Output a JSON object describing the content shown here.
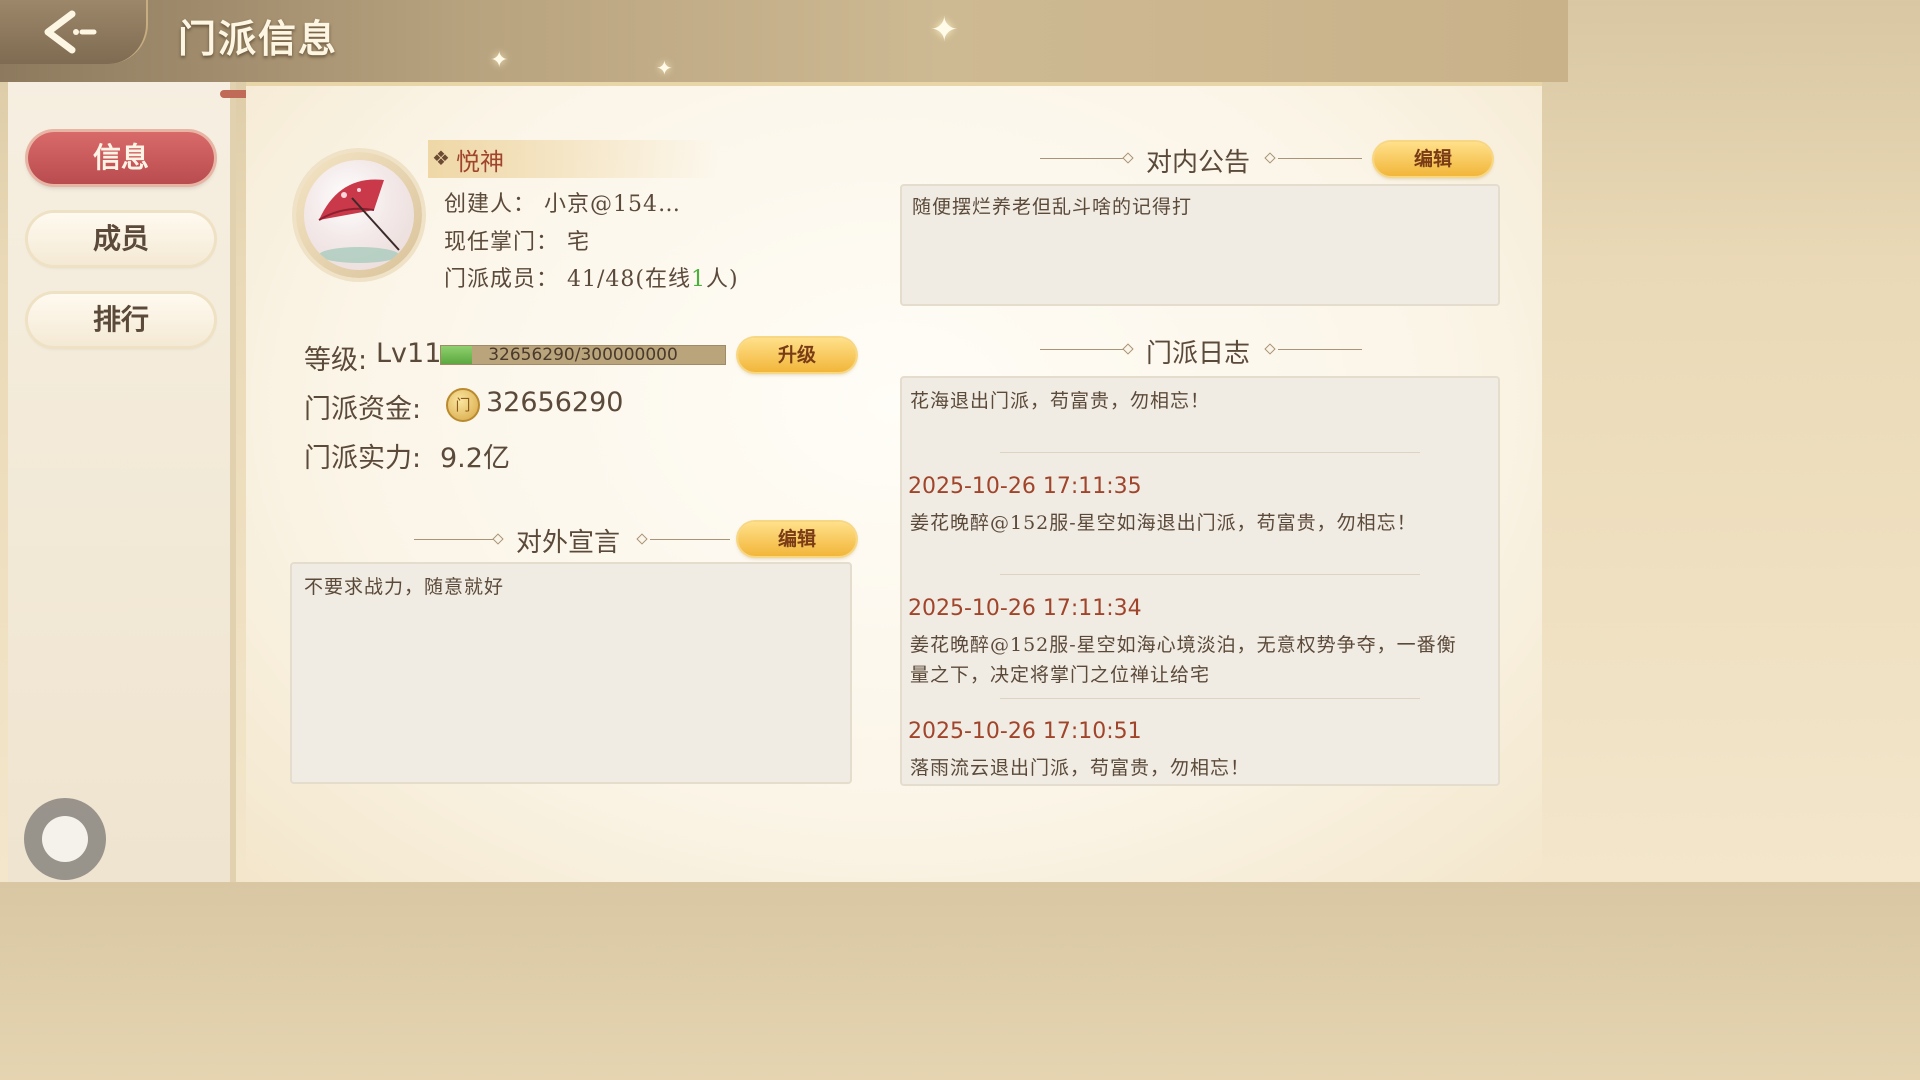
{
  "header": {
    "title": "门派信息"
  },
  "sidebar": {
    "items": [
      {
        "label": "信息",
        "active": true
      },
      {
        "label": "成员",
        "active": false
      },
      {
        "label": "排行",
        "active": false
      }
    ]
  },
  "guild": {
    "name": "悦神",
    "creator_line": "创建人： 小京@154…",
    "leader_line": "现任掌门： 宅",
    "members_prefix": "门派成员： 41/48(在线",
    "members_online": "1",
    "members_suffix": "人)"
  },
  "stats": {
    "level_label": "等级:",
    "level_value": "Lv11",
    "xp_text": "32656290/300000000",
    "xp_fraction": 0.1089,
    "upgrade_label": "升级",
    "funds_label": "门派资金:",
    "coin_glyph": "门",
    "funds_value": "32656290",
    "power_label": "门派实力:",
    "power_value": "9.2亿"
  },
  "declaration": {
    "heading": "对外宣言",
    "edit_label": "编辑",
    "text": "不要求战力，随意就好"
  },
  "notice": {
    "heading": "对内公告",
    "edit_label": "编辑",
    "text": "随便摆烂养老但乱斗啥的记得打"
  },
  "log": {
    "heading": "门派日志",
    "entries": [
      {
        "time": "",
        "text": "花海退出门派，苟富贵，勿相忘！"
      },
      {
        "time": "2025-10-26  17:11:35",
        "text": "姜花晚醉@152服-星空如海退出门派，苟富贵，勿相忘！"
      },
      {
        "time": "2025-10-26  17:11:34",
        "text": "姜花晚醉@152服-星空如海心境淡泊，无意权势争夺，一番衡",
        "text2": "量之下，决定将掌门之位禅让给宅"
      },
      {
        "time": "2025-10-26  17:10:51",
        "text": "落雨流云退出门派，苟富贵，勿相忘！"
      }
    ]
  },
  "colors": {
    "accent_red": "#b94c4f",
    "gold_button": "#f2b63a",
    "xp_green": "#5ba83f",
    "time_red": "#a0452b"
  }
}
